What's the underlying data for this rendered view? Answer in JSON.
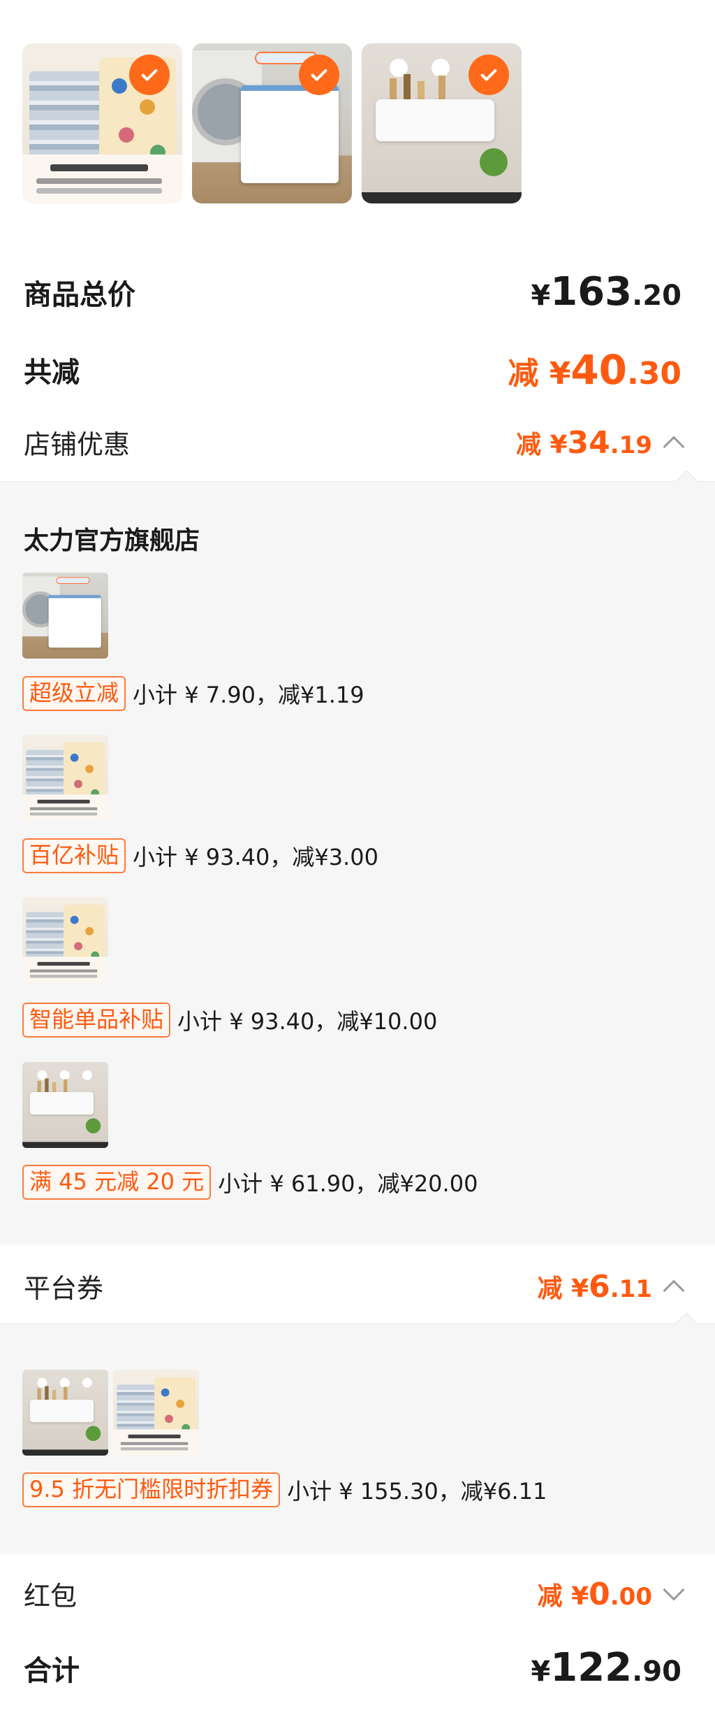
{
  "summary": {
    "total_label": "商品总价",
    "total": {
      "yen": "¥",
      "int": "163",
      "dec": ".20"
    },
    "reduce_label": "共减",
    "reduce": {
      "prefix": "减 ¥",
      "int": "40",
      "dec": ".30"
    },
    "shop_discount_label": "店铺优惠",
    "shop_discount": {
      "prefix": "减 ¥",
      "int": "34",
      "dec": ".19"
    }
  },
  "shop": {
    "name": "太力官方旗舰店",
    "items": [
      {
        "tag": "超级立减",
        "text": "小计 ¥ 7.90，减¥1.19",
        "image": "net-bag"
      },
      {
        "tag": "百亿补贴",
        "text": "小计 ¥ 93.40，减¥3.00",
        "image": "storage-bag"
      },
      {
        "tag": "智能单品补贴",
        "text": "小计 ¥ 93.40，减¥10.00",
        "image": "storage-bag"
      },
      {
        "tag": "满 45 元减 20 元",
        "text": "小计 ¥ 61.90，减¥20.00",
        "image": "wall-shelf"
      }
    ]
  },
  "platform": {
    "label": "平台券",
    "amount": {
      "prefix": "减 ¥",
      "int": "6",
      "dec": ".11"
    },
    "coupon_tag": "9.5 折无门槛限时折扣券",
    "coupon_text": "小计 ¥ 155.30，减¥6.11"
  },
  "redpacket": {
    "label": "红包",
    "amount": {
      "prefix": "减 ¥",
      "int": "0",
      "dec": ".00"
    }
  },
  "grand_total": {
    "label": "合计",
    "amount": {
      "yen": "¥",
      "int": "122",
      "dec": ".90"
    }
  },
  "colors": {
    "accent": "#ff5a10",
    "check": "#ff6a1a"
  },
  "icons": [
    "check-icon",
    "chevron-up-icon",
    "chevron-down-icon"
  ]
}
